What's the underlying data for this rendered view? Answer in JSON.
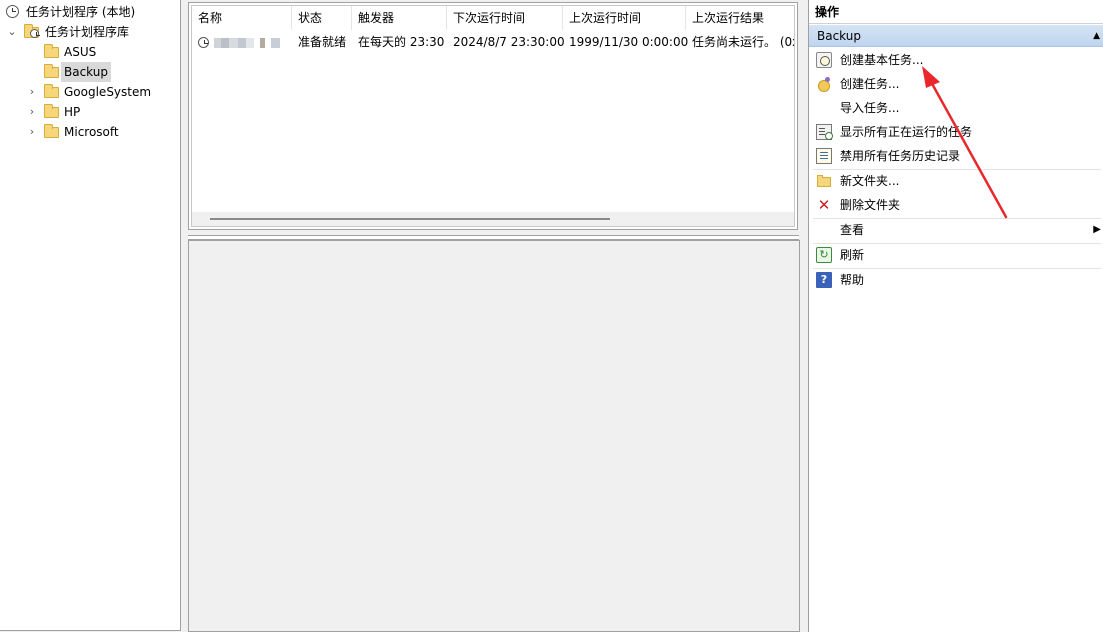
{
  "tree": {
    "root_label": "任务计划程序 (本地)",
    "library_label": "任务计划程序库",
    "folders": [
      {
        "label": "ASUS",
        "expandable": false,
        "selected": false
      },
      {
        "label": "Backup",
        "expandable": false,
        "selected": true
      },
      {
        "label": "GoogleSystem",
        "expandable": true,
        "selected": false
      },
      {
        "label": "HP",
        "expandable": true,
        "selected": false
      },
      {
        "label": "Microsoft",
        "expandable": true,
        "selected": false
      }
    ]
  },
  "task_list": {
    "columns": [
      "名称",
      "状态",
      "触发器",
      "下次运行时间",
      "上次运行时间",
      "上次运行结果"
    ],
    "rows": [
      {
        "name": "",
        "status": "准备就绪",
        "trigger": "在每天的 23:30",
        "next_run": "2024/8/7 23:30:00",
        "last_run": "1999/11/30 0:00:00",
        "last_result": "任务尚未运行。 (0x"
      }
    ]
  },
  "actions": {
    "title": "操作",
    "section": "Backup",
    "collapse_glyph": "▲",
    "items": [
      {
        "label": "创建基本任务...",
        "icon": "create-basic-task-icon"
      },
      {
        "label": "创建任务...",
        "icon": "create-task-icon"
      },
      {
        "label": "导入任务...",
        "icon": ""
      },
      {
        "label": "显示所有正在运行的任务",
        "icon": "running-tasks-icon"
      },
      {
        "label": "禁用所有任务历史记录",
        "icon": "task-history-icon"
      },
      {
        "label": "新文件夹...",
        "icon": "new-folder-icon"
      },
      {
        "label": "删除文件夹",
        "icon": "delete-icon"
      },
      {
        "label": "查看",
        "icon": "",
        "submenu": true
      },
      {
        "label": "刷新",
        "icon": "refresh-icon"
      },
      {
        "label": "帮助",
        "icon": "help-icon"
      }
    ]
  },
  "colors": {
    "section_header": "#c8dbf2",
    "annotation_arrow": "#e8282d",
    "delete_icon": "#d32020",
    "help_icon": "#3a62b8"
  }
}
